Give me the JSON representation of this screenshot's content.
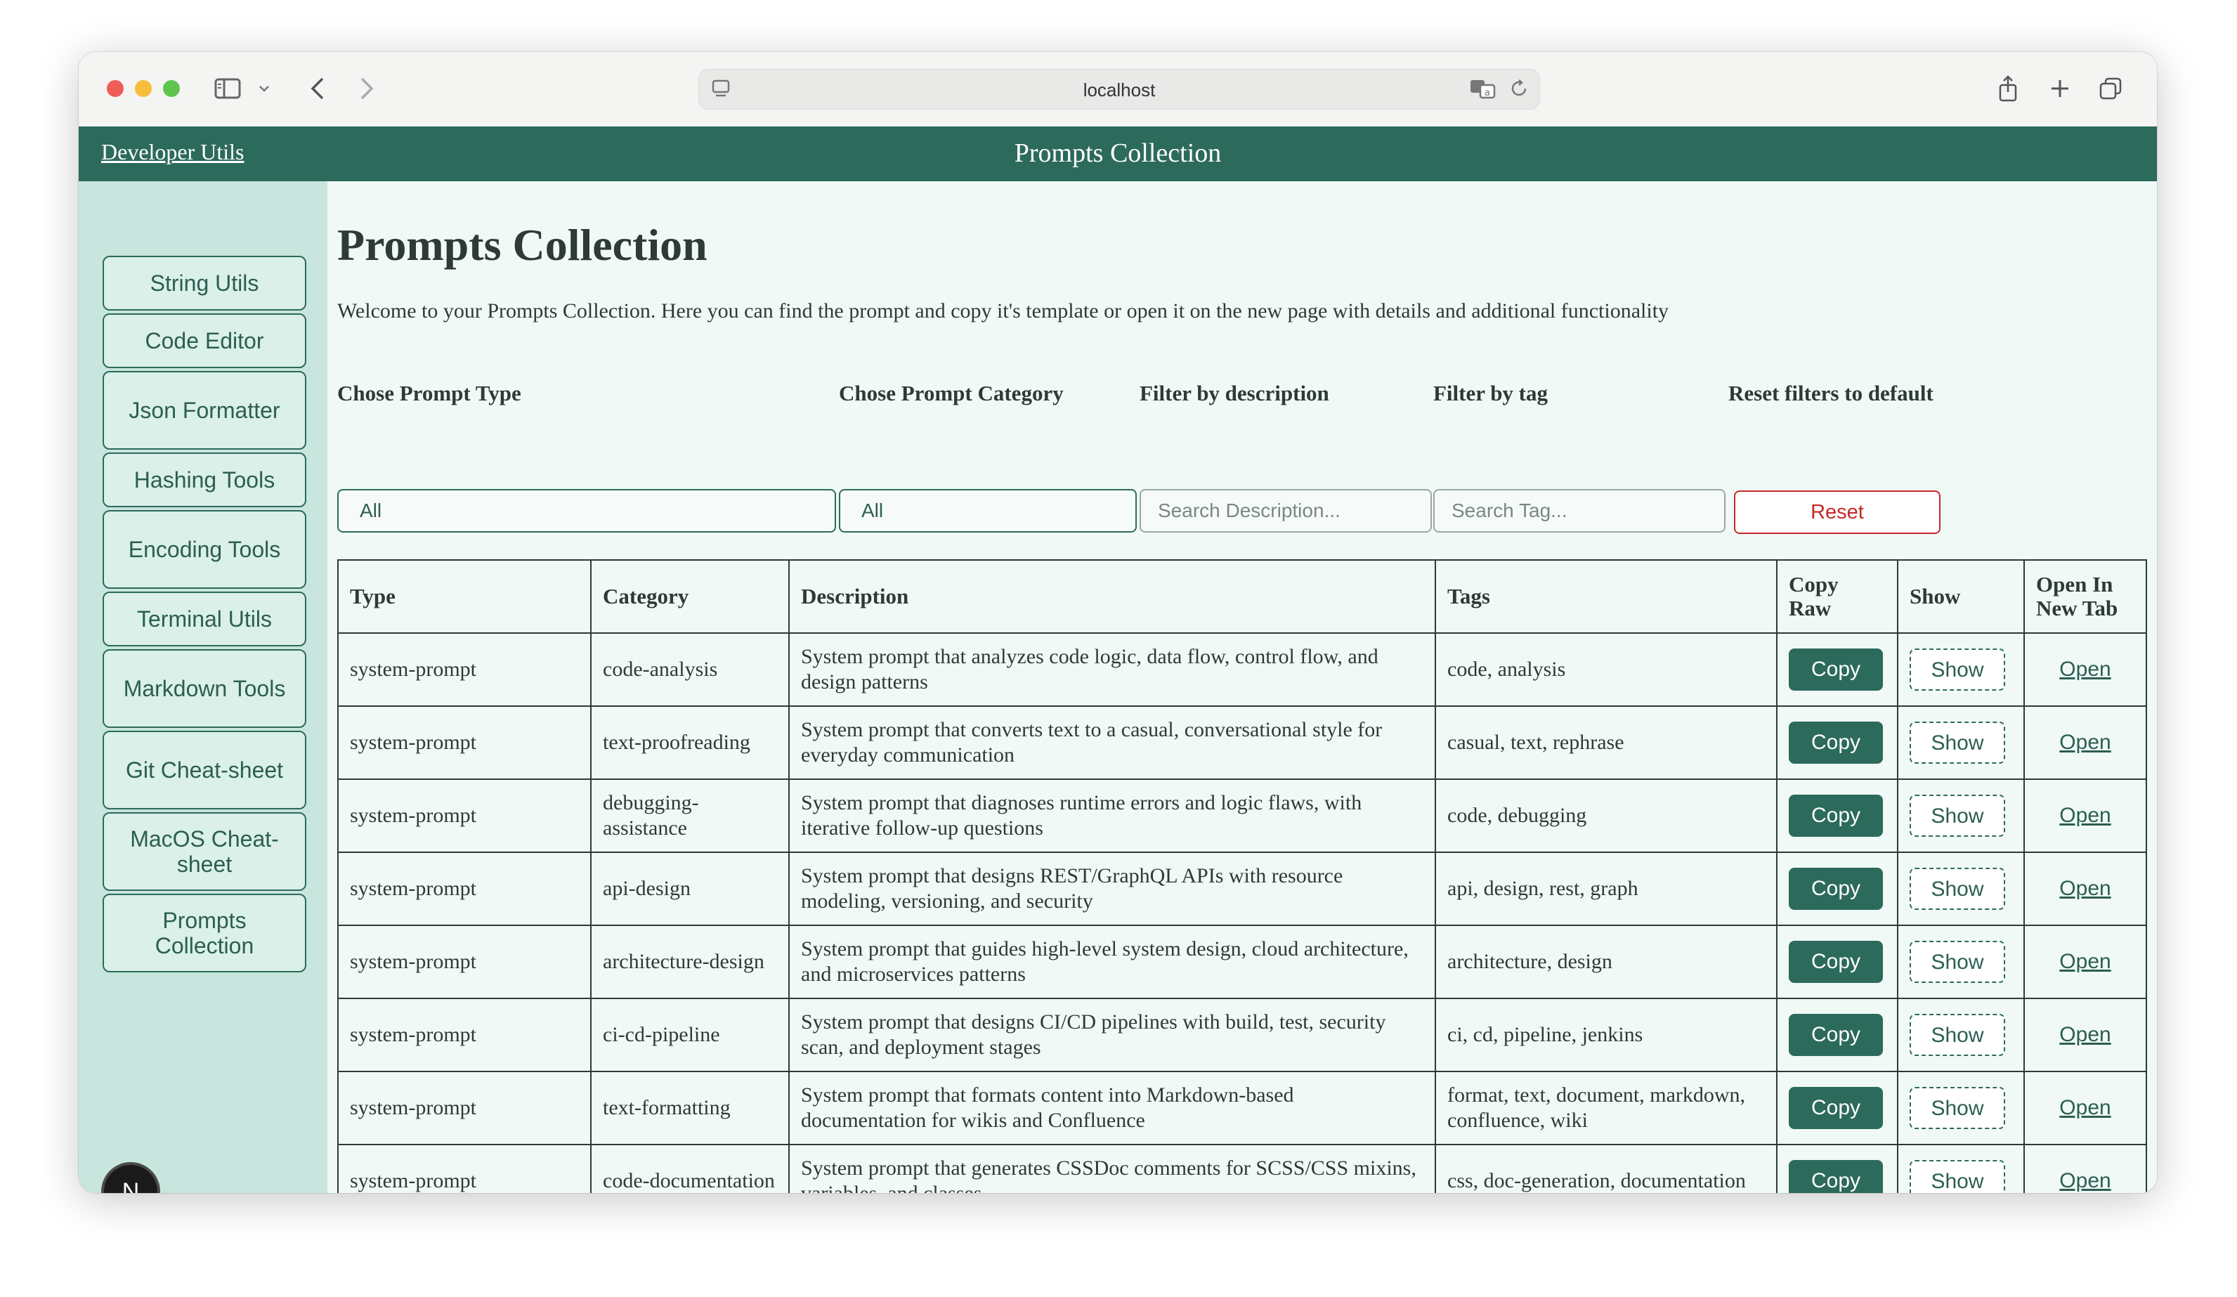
{
  "browser": {
    "url": "localhost"
  },
  "header": {
    "brand": "Developer Utils",
    "title": "Prompts Collection"
  },
  "sidebar": {
    "items": [
      {
        "label": "String Utils"
      },
      {
        "label": "Code Editor"
      },
      {
        "label": "Json Formatter"
      },
      {
        "label": "Hashing Tools"
      },
      {
        "label": "Encoding Tools"
      },
      {
        "label": "Terminal Utils"
      },
      {
        "label": "Markdown Tools"
      },
      {
        "label": "Git Cheat-sheet"
      },
      {
        "label": "MacOS Cheat-sheet"
      },
      {
        "label": "Prompts Collection"
      }
    ],
    "fab": "N"
  },
  "main": {
    "title": "Prompts Collection",
    "intro": "Welcome to your Prompts Collection. Here you can find the prompt and copy it's template or open it on the new page with details and additional functionality"
  },
  "filters": {
    "type_label": "Chose Prompt Type",
    "category_label": "Chose Prompt Category",
    "description_label": "Filter by description",
    "tag_label": "Filter by tag",
    "reset_label": "Reset filters to default",
    "type_value": "All",
    "category_value": "All",
    "description_placeholder": "Search Description...",
    "tag_placeholder": "Search Tag...",
    "reset_button": "Reset"
  },
  "table": {
    "headers": {
      "type": "Type",
      "category": "Category",
      "description": "Description",
      "tags": "Tags",
      "copy_raw": "Copy Raw",
      "show": "Show",
      "open": "Open In New Tab"
    },
    "copy_label": "Copy",
    "show_label": "Show",
    "open_label": "Open",
    "rows": [
      {
        "type": "system-prompt",
        "category": "code-analysis",
        "description": "System prompt that analyzes code logic, data flow, control flow, and design patterns",
        "tags": "code, analysis"
      },
      {
        "type": "system-prompt",
        "category": "text-proofreading",
        "description": "System prompt that converts text to a casual, conversational style for everyday communication",
        "tags": "casual, text, rephrase"
      },
      {
        "type": "system-prompt",
        "category": "debugging-assistance",
        "description": "System prompt that diagnoses runtime errors and logic flaws, with iterative follow-up questions",
        "tags": "code, debugging"
      },
      {
        "type": "system-prompt",
        "category": "api-design",
        "description": "System prompt that designs REST/GraphQL APIs with resource modeling, versioning, and security",
        "tags": "api, design, rest, graph"
      },
      {
        "type": "system-prompt",
        "category": "architecture-design",
        "description": "System prompt that guides high-level system design, cloud architecture, and microservices patterns",
        "tags": "architecture, design"
      },
      {
        "type": "system-prompt",
        "category": "ci-cd-pipeline",
        "description": "System prompt that designs CI/CD pipelines with build, test, security scan, and deployment stages",
        "tags": "ci, cd, pipeline, jenkins"
      },
      {
        "type": "system-prompt",
        "category": "text-formatting",
        "description": "System prompt that formats content into Markdown-based documentation for wikis and Confluence",
        "tags": "format, text, document, markdown, confluence, wiki"
      },
      {
        "type": "system-prompt",
        "category": "code-documentation",
        "description": "System prompt that generates CSSDoc comments for SCSS/CSS mixins, variables, and classes",
        "tags": "css, doc-generation, documentation"
      }
    ]
  }
}
